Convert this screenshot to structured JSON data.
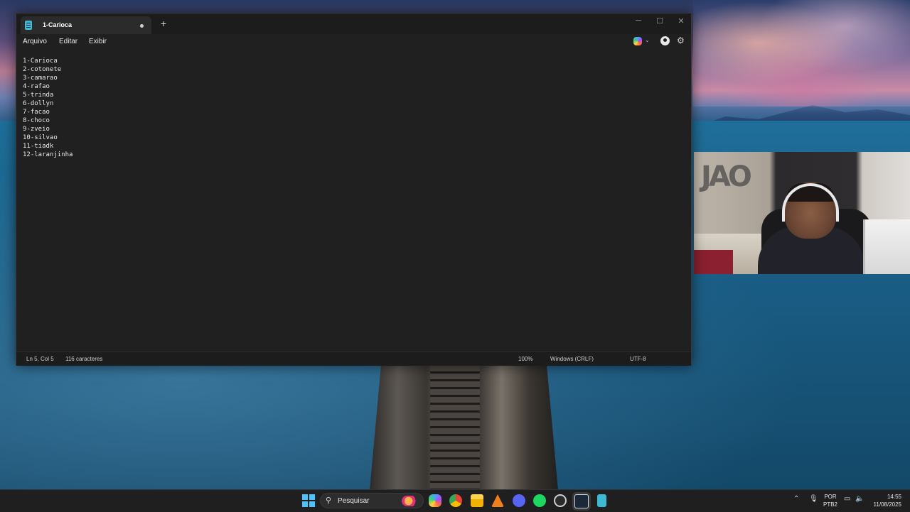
{
  "notepad": {
    "tab_title": "1-Carioca",
    "menu": [
      "Arquivo",
      "Editar",
      "Exibir"
    ],
    "lines": [
      "1-Carioca",
      "2-cotonete",
      "3-camarao",
      "4-rafao",
      "5-trinda",
      "6-dollyn",
      "7-facao",
      "8-choco",
      "9-zveio",
      "10-silvao",
      "11-tiadk",
      "12-laranjinha"
    ],
    "status": {
      "position": "Ln 5, Col 5",
      "chars": "116 caracteres",
      "zoom": "100%",
      "line_ending": "Windows (CRLF)",
      "encoding": "UTF-8"
    },
    "icons": {
      "app": "notepad-icon",
      "new_tab": "plus-icon",
      "copilot": "copilot-icon",
      "account": "account-icon",
      "settings": "gear-icon"
    }
  },
  "taskbar": {
    "search_placeholder": "Pesquisar",
    "lang_top": "POR",
    "lang_bottom": "PTB2",
    "time": "14:55",
    "date": "11/08/2025",
    "apps": [
      "start-icon",
      "copilot-icon",
      "chrome-icon",
      "file-explorer-icon",
      "app-a-icon",
      "discord-icon",
      "spotify-icon",
      "obs-icon",
      "steam-icon",
      "notepad-icon"
    ]
  },
  "colors": {
    "window_bg": "#202020",
    "accent": "#4cc2ff"
  }
}
